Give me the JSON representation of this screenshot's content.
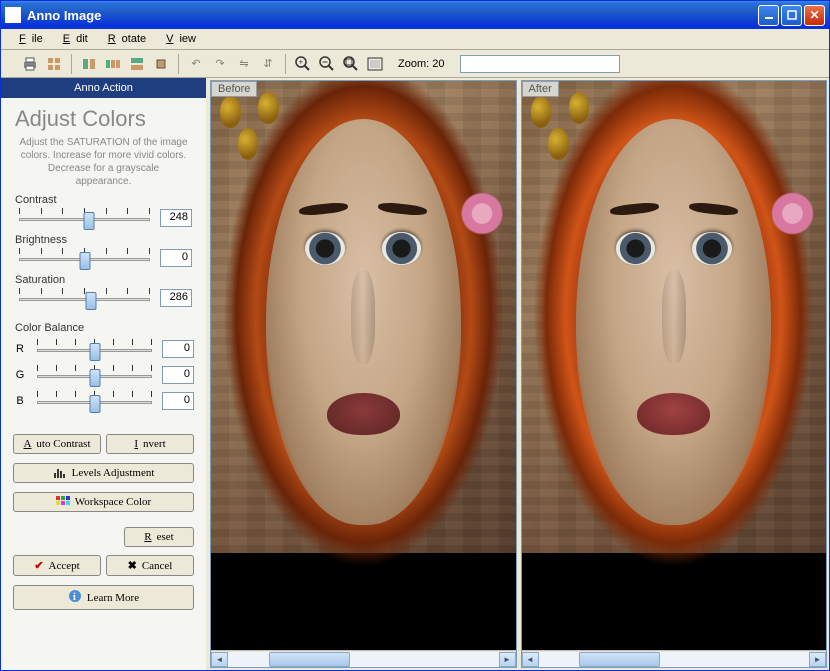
{
  "window": {
    "title": "Anno Image"
  },
  "menu": {
    "file": "File",
    "edit": "Edit",
    "rotate": "Rotate",
    "view": "View"
  },
  "toolbar": {
    "zoom_label": "Zoom: 20"
  },
  "sidebar": {
    "header": "Anno Action",
    "title": "Adjust Colors",
    "description": "Adjust the SATURATION of the image colors. Increase for more vivid colors. Decrease for a grayscale appearance.",
    "contrast": {
      "label": "Contrast",
      "value": "248"
    },
    "brightness": {
      "label": "Brightness",
      "value": "0"
    },
    "saturation": {
      "label": "Saturation",
      "value": "286"
    },
    "color_balance": {
      "label": "Color Balance",
      "r": "R",
      "g": "G",
      "b": "B",
      "r_val": "0",
      "g_val": "0",
      "b_val": "0"
    },
    "buttons": {
      "auto_contrast": "Auto Contrast",
      "invert": "Invert",
      "levels": "Levels Adjustment",
      "workspace": "Workspace Color",
      "reset": "Reset",
      "accept": "Accept",
      "cancel": "Cancel",
      "learn": "Learn More"
    }
  },
  "preview": {
    "before": "Before",
    "after": "After"
  }
}
